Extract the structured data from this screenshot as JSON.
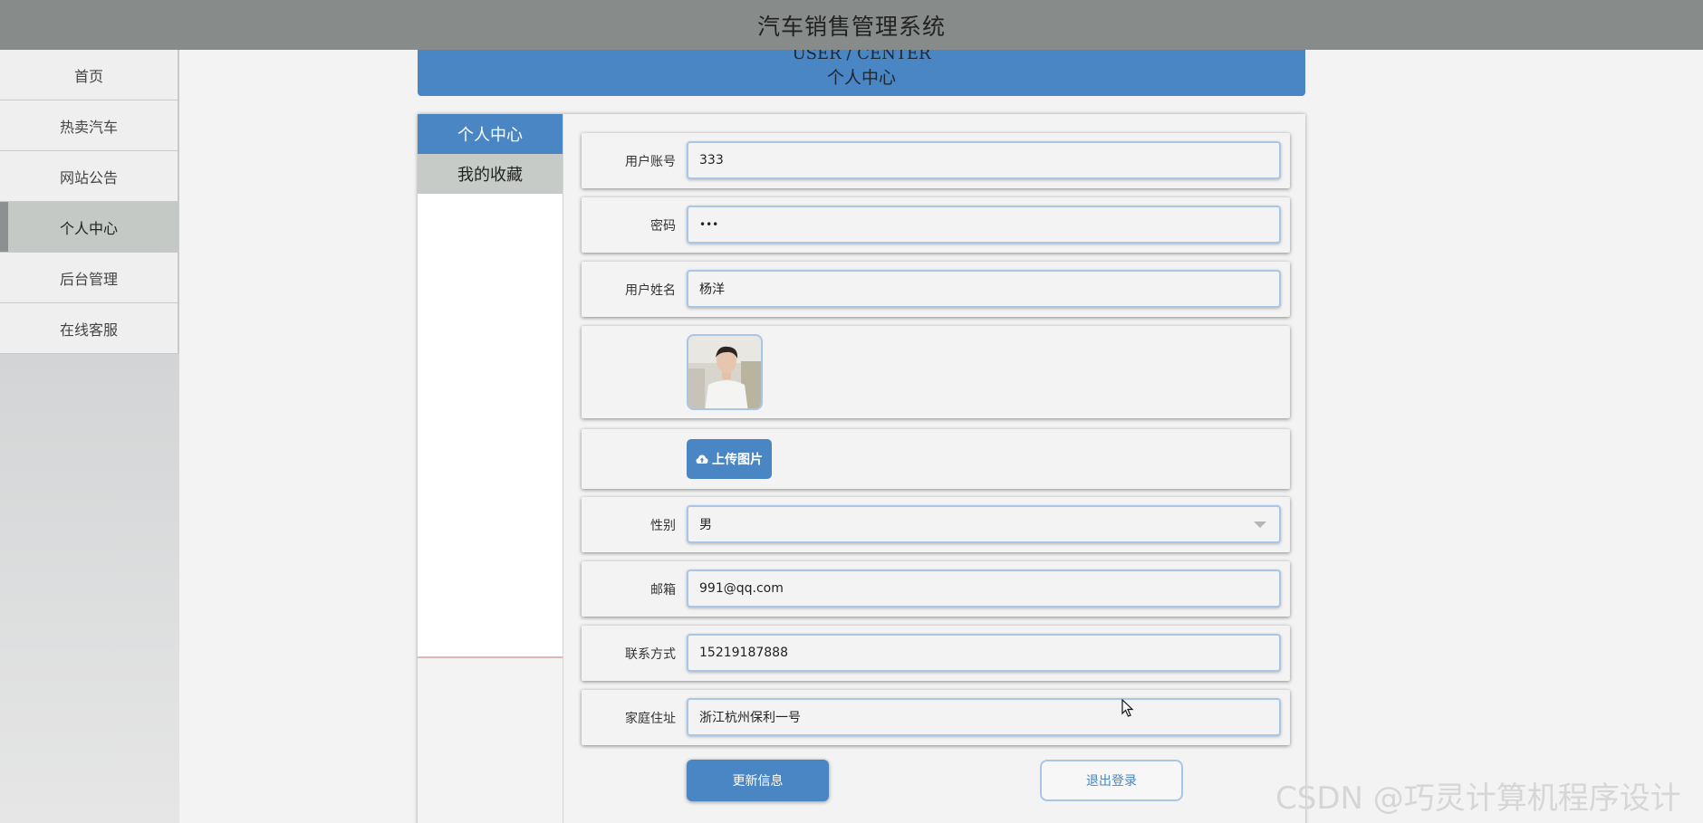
{
  "app": {
    "title": "汽车销售管理系统"
  },
  "sidebar": {
    "items": [
      {
        "label": "首页"
      },
      {
        "label": "热卖汽车"
      },
      {
        "label": "网站公告"
      },
      {
        "label": "个人中心",
        "active": true
      },
      {
        "label": "后台管理"
      },
      {
        "label": "在线客服"
      }
    ]
  },
  "banner": {
    "en": "USER / CENTER",
    "cn": "个人中心"
  },
  "subnav": {
    "items": [
      {
        "label": "个人中心",
        "active": true
      },
      {
        "label": "我的收藏"
      }
    ]
  },
  "form": {
    "account": {
      "label": "用户账号",
      "value": "333"
    },
    "password": {
      "label": "密码",
      "value": "•••"
    },
    "name": {
      "label": "用户姓名",
      "value": "杨洋"
    },
    "upload": {
      "label": "上传图片",
      "icon": "cloud-upload-icon"
    },
    "gender": {
      "label": "性别",
      "value": "男"
    },
    "email": {
      "label": "邮箱",
      "value": "991@qq.com"
    },
    "phone": {
      "label": "联系方式",
      "value": "15219187888"
    },
    "address": {
      "label": "家庭住址",
      "value": "浙江杭州保利一号"
    }
  },
  "actions": {
    "update": "更新信息",
    "logout": "退出登录"
  },
  "watermark": "CSDN @巧灵计算机程序设计",
  "colors": {
    "accent": "#4a86c4",
    "topbar": "#878b8a",
    "active_nav": "#c5c9c6"
  }
}
